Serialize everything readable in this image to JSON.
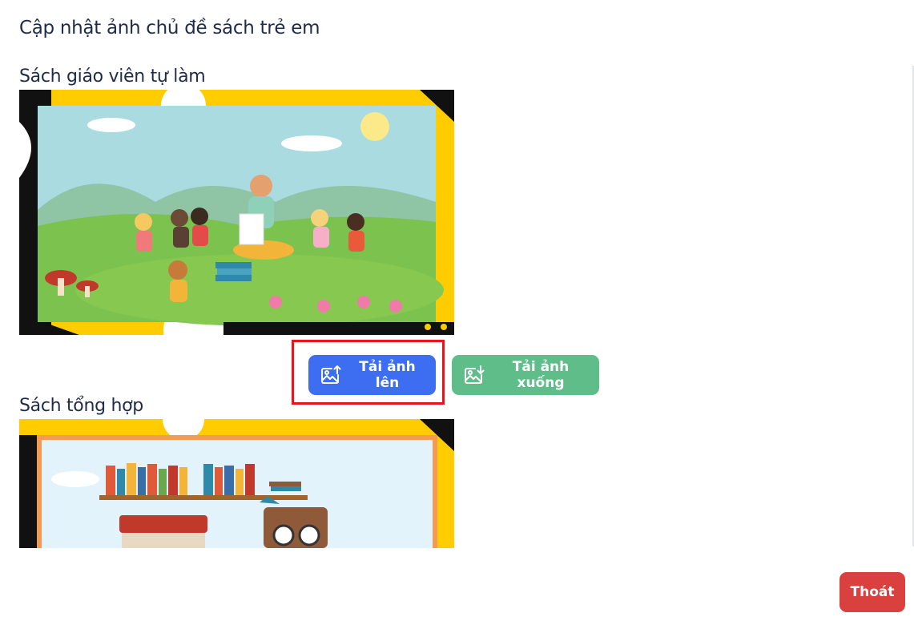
{
  "header": {
    "title": "Cập nhật ảnh chủ đề sách trẻ em"
  },
  "sections": [
    {
      "title": "Sách giáo viên tự làm",
      "image_desc_icon": "classroom-illustration",
      "upload_label": "Tải ảnh lên",
      "download_label": "Tải ảnh xuống"
    },
    {
      "title": "Sách tổng hợp",
      "image_desc_icon": "bookshelf-illustration"
    }
  ],
  "footer": {
    "exit_label": "Thoát"
  },
  "colors": {
    "upload": "#3d6ef2",
    "download": "#5fbd8a",
    "exit": "#d9403e",
    "frame": "#ffcc00",
    "highlight": "#e8141e"
  }
}
